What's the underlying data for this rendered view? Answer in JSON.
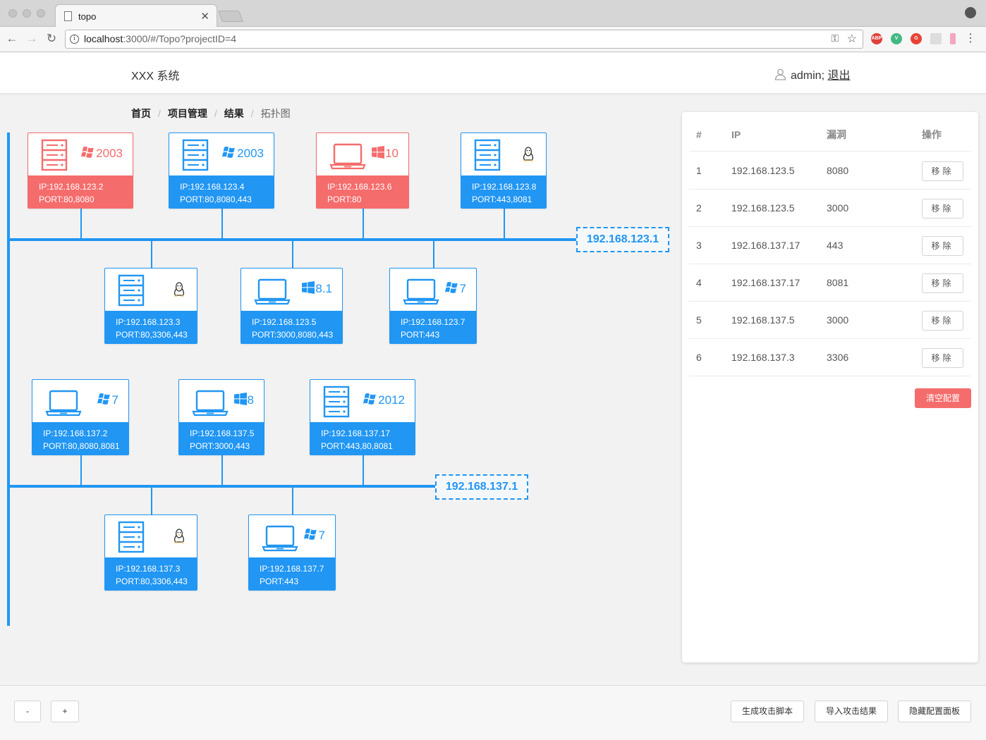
{
  "browser": {
    "tab_title": "topo",
    "url_host": "localhost",
    "url_path": ":3000/#/Topo?projectID=4",
    "extensions": [
      "ABP",
      "V",
      "G",
      "",
      ""
    ]
  },
  "header": {
    "brand": "XXX 系统",
    "user": "admin;",
    "logout": "退出"
  },
  "breadcrumb": [
    "首页",
    "项目管理",
    "结果",
    "拓扑图"
  ],
  "colors": {
    "normal": "#2196f3",
    "vulnerable": "#f56c6c"
  },
  "networks": [
    {
      "gateway": "192.168.123.1",
      "hosts": [
        {
          "device": "server-icon",
          "os_icon": "windows-xp-icon",
          "os_version": "2003",
          "ip": "IP:192.168.123.2",
          "ports": "PORT:80,8080",
          "vulnerable": true
        },
        {
          "device": "server-icon",
          "os_icon": "windows-xp-icon",
          "os_version": "2003",
          "ip": "IP:192.168.123.4",
          "ports": "PORT:80,8080,443",
          "vulnerable": false
        },
        {
          "device": "laptop-icon",
          "os_icon": "windows-10-icon",
          "os_version": "10",
          "ip": "IP:192.168.123.6",
          "ports": "PORT:80",
          "vulnerable": true
        },
        {
          "device": "server-icon",
          "os_icon": "linux-icon",
          "os_version": "",
          "ip": "IP:192.168.123.8",
          "ports": "PORT:443,8081",
          "vulnerable": false
        },
        {
          "device": "server-icon",
          "os_icon": "linux-icon",
          "os_version": "",
          "ip": "IP:192.168.123.3",
          "ports": "PORT:80,3306,443",
          "vulnerable": false
        },
        {
          "device": "laptop-icon",
          "os_icon": "windows-10-icon",
          "os_version": "8.1",
          "ip": "IP:192.168.123.5",
          "ports": "PORT:3000,8080,443",
          "vulnerable": false
        },
        {
          "device": "laptop-icon",
          "os_icon": "windows-xp-icon",
          "os_version": "7",
          "ip": "IP:192.168.123.7",
          "ports": "PORT:443",
          "vulnerable": false
        }
      ]
    },
    {
      "gateway": "192.168.137.1",
      "hosts": [
        {
          "device": "laptop-icon",
          "os_icon": "windows-xp-icon",
          "os_version": "7",
          "ip": "IP:192.168.137.2",
          "ports": "PORT:80,8080,8081",
          "vulnerable": false
        },
        {
          "device": "laptop-icon",
          "os_icon": "windows-10-icon",
          "os_version": "8",
          "ip": "IP:192.168.137.5",
          "ports": "PORT:3000,443",
          "vulnerable": false
        },
        {
          "device": "server-icon",
          "os_icon": "windows-xp-icon",
          "os_version": "2012",
          "ip": "IP:192.168.137.17",
          "ports": "PORT:443,80,8081",
          "vulnerable": false
        },
        {
          "device": "server-icon",
          "os_icon": "linux-icon",
          "os_version": "",
          "ip": "IP:192.168.137.3",
          "ports": "PORT:80,3306,443",
          "vulnerable": false
        },
        {
          "device": "laptop-icon",
          "os_icon": "windows-xp-icon",
          "os_version": "7",
          "ip": "IP:192.168.137.7",
          "ports": "PORT:443",
          "vulnerable": false
        }
      ]
    }
  ],
  "config_table": {
    "headers": [
      "#",
      "IP",
      "漏洞",
      "操作"
    ],
    "rows": [
      {
        "index": "1",
        "ip": "192.168.123.5",
        "vuln": "8080",
        "action": "移除"
      },
      {
        "index": "2",
        "ip": "192.168.123.5",
        "vuln": "3000",
        "action": "移除"
      },
      {
        "index": "3",
        "ip": "192.168.137.17",
        "vuln": "443",
        "action": "移除"
      },
      {
        "index": "4",
        "ip": "192.168.137.17",
        "vuln": "8081",
        "action": "移除"
      },
      {
        "index": "5",
        "ip": "192.168.137.5",
        "vuln": "3000",
        "action": "移除"
      },
      {
        "index": "6",
        "ip": "192.168.137.3",
        "vuln": "3306",
        "action": "移除"
      }
    ],
    "clear_label": "清空配置"
  },
  "footer": {
    "zoom_out": "-",
    "zoom_in": "+",
    "generate": "生成攻击脚本",
    "import": "导入攻击结果",
    "hide_panel": "隐藏配置面板"
  }
}
